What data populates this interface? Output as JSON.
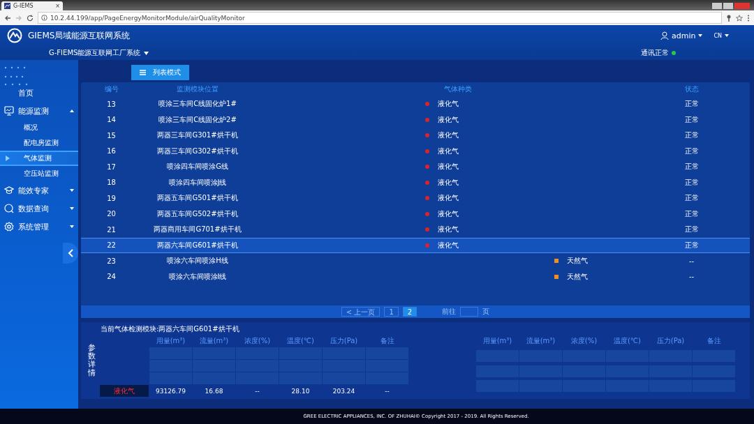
{
  "browser": {
    "tab_title": "G-IEMS",
    "tab_close": "×",
    "url": "10.2.44.199/app/PageEnergyMonitorModule/airQualityMonitor"
  },
  "header": {
    "app_title": "GIEMS局域能源互联网系统",
    "user": "admin",
    "language": "CN",
    "system": "G-FIEMS能源互联网工厂系统",
    "connection": {
      "label": "通讯正常",
      "color": "#22cc44"
    }
  },
  "sidebar": {
    "items": [
      {
        "label": "首页"
      },
      {
        "label": "能源监测",
        "expanded": true,
        "children": [
          {
            "label": "概况",
            "selected": false
          },
          {
            "label": "配电房监测",
            "selected": false
          },
          {
            "label": "气体监测",
            "selected": true
          },
          {
            "label": "空压站监测",
            "selected": false
          }
        ]
      },
      {
        "label": "能效专家",
        "expanded": false
      },
      {
        "label": "数据查询",
        "expanded": false
      },
      {
        "label": "系统管理",
        "expanded": false
      }
    ]
  },
  "view_tabs": [
    {
      "label": "列表模式",
      "selected": true
    }
  ],
  "table": {
    "columns": [
      "编号",
      "监测模块位置",
      "气体种类",
      "状态"
    ],
    "rows": [
      {
        "number": "13",
        "location": "喷涂三车间C线固化炉1#",
        "gas_a": {
          "label": "液化气",
          "color": "#e0202a"
        },
        "status": "正常",
        "selected": false
      },
      {
        "number": "14",
        "location": "喷涂三车间C线固化炉2#",
        "gas_a": {
          "label": "液化气",
          "color": "#e0202a"
        },
        "status": "正常",
        "selected": false
      },
      {
        "number": "15",
        "location": "两器三车间G301#烘干机",
        "gas_a": {
          "label": "液化气",
          "color": "#e0202a"
        },
        "status": "正常",
        "selected": false
      },
      {
        "number": "16",
        "location": "两器三车间G302#烘干机",
        "gas_a": {
          "label": "液化气",
          "color": "#e0202a"
        },
        "status": "正常",
        "selected": false
      },
      {
        "number": "17",
        "location": "喷涂四车间喷涂G线",
        "gas_a": {
          "label": "液化气",
          "color": "#e0202a"
        },
        "status": "正常",
        "selected": false
      },
      {
        "number": "18",
        "location": "喷涂四车间喷涂J线",
        "gas_a": {
          "label": "液化气",
          "color": "#e0202a"
        },
        "status": "正常",
        "selected": false
      },
      {
        "number": "19",
        "location": "两器五车间G501#烘干机",
        "gas_a": {
          "label": "液化气",
          "color": "#e0202a"
        },
        "status": "正常",
        "selected": false
      },
      {
        "number": "20",
        "location": "两器五车间G502#烘干机",
        "gas_a": {
          "label": "液化气",
          "color": "#e0202a"
        },
        "status": "正常",
        "selected": false
      },
      {
        "number": "21",
        "location": "两器商用车间G701#烘干机",
        "gas_a": {
          "label": "液化气",
          "color": "#e0202a"
        },
        "status": "正常",
        "selected": false
      },
      {
        "number": "22",
        "location": "两器六车间G601#烘干机",
        "gas_a": {
          "label": "液化气",
          "color": "#e0202a"
        },
        "status": "正常",
        "selected": true
      },
      {
        "number": "23",
        "location": "喷涂六车间喷涂H线",
        "gas_b": {
          "label": "天然气",
          "color": "#e8902a"
        },
        "status": "--",
        "selected": false
      },
      {
        "number": "24",
        "location": "喷涂六车间喷涂I线",
        "gas_b": {
          "label": "天然气",
          "color": "#e8902a"
        },
        "status": "--",
        "selected": false
      }
    ]
  },
  "pagination": {
    "prev": "< 上一页",
    "pages": [
      {
        "label": "1",
        "selected": false
      },
      {
        "label": "2",
        "selected": true
      }
    ],
    "goto_label": "前往",
    "goto_suffix": "页"
  },
  "details": {
    "title": "当前气体检测模块:两器六车间G601#烘干机",
    "side_label": "参数详情",
    "left_table": {
      "columns": [
        "用量(m³)",
        "流量(m³)",
        "浓度(%)",
        "温度(℃)",
        "压力(Pa)",
        "备注"
      ],
      "gas": "液化气",
      "values": [
        "93126.79",
        "16.68",
        "--",
        "28.10",
        "203.24",
        "--"
      ]
    },
    "right_table": {
      "columns": [
        "用量(m³)",
        "流量(m³)",
        "浓度(%)",
        "温度(℃)",
        "压力(Pa)",
        "备注"
      ]
    }
  },
  "footer": "GREE ELECTRIC APPLIANCES, INC. OF ZHUHAI© Copyright 2017 - 2019. All Rights Reserved."
}
